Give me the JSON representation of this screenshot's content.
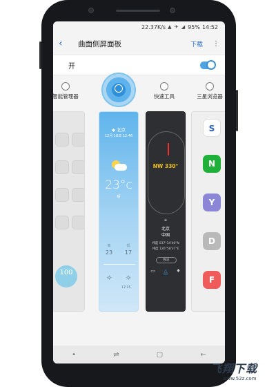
{
  "statusbar": {
    "speed": "22.37K/s",
    "battery": "95%",
    "time": "14:52"
  },
  "appbar": {
    "title": "曲面侧屏面板",
    "download": "下载",
    "more": "⋮"
  },
  "toggle": {
    "label": "开",
    "on": true
  },
  "panels": [
    {
      "label": "智能管理器"
    },
    {
      "label": ""
    },
    {
      "label": "快速工具"
    },
    {
      "label": "三星浏览器"
    }
  ],
  "weather": {
    "location": "北京",
    "date": "12月 18日 12:46",
    "temp": "23°c",
    "desc": "晴",
    "high_label": "高",
    "low_label": "低",
    "high": "23",
    "low": "17",
    "sunrise": "",
    "sunset": "17:15"
  },
  "compass": {
    "reading": "NW 330°",
    "city": "北京",
    "country": "中国",
    "lat": "纬度 037°34'46\"N",
    "lon": "纬度 126°58'37\"E",
    "calibrate": "校正"
  },
  "smart_manager": {
    "battery_value": "100"
  },
  "apps": [
    "S",
    "N",
    "Y",
    "D",
    "F"
  ],
  "app_colors": [
    "#ffffff",
    "#1fb03a",
    "#8b86d6",
    "#b9b9b9",
    "#ef5b5b"
  ],
  "watermark": {
    "title": "飞翔下载",
    "url": "www.52z.com"
  }
}
